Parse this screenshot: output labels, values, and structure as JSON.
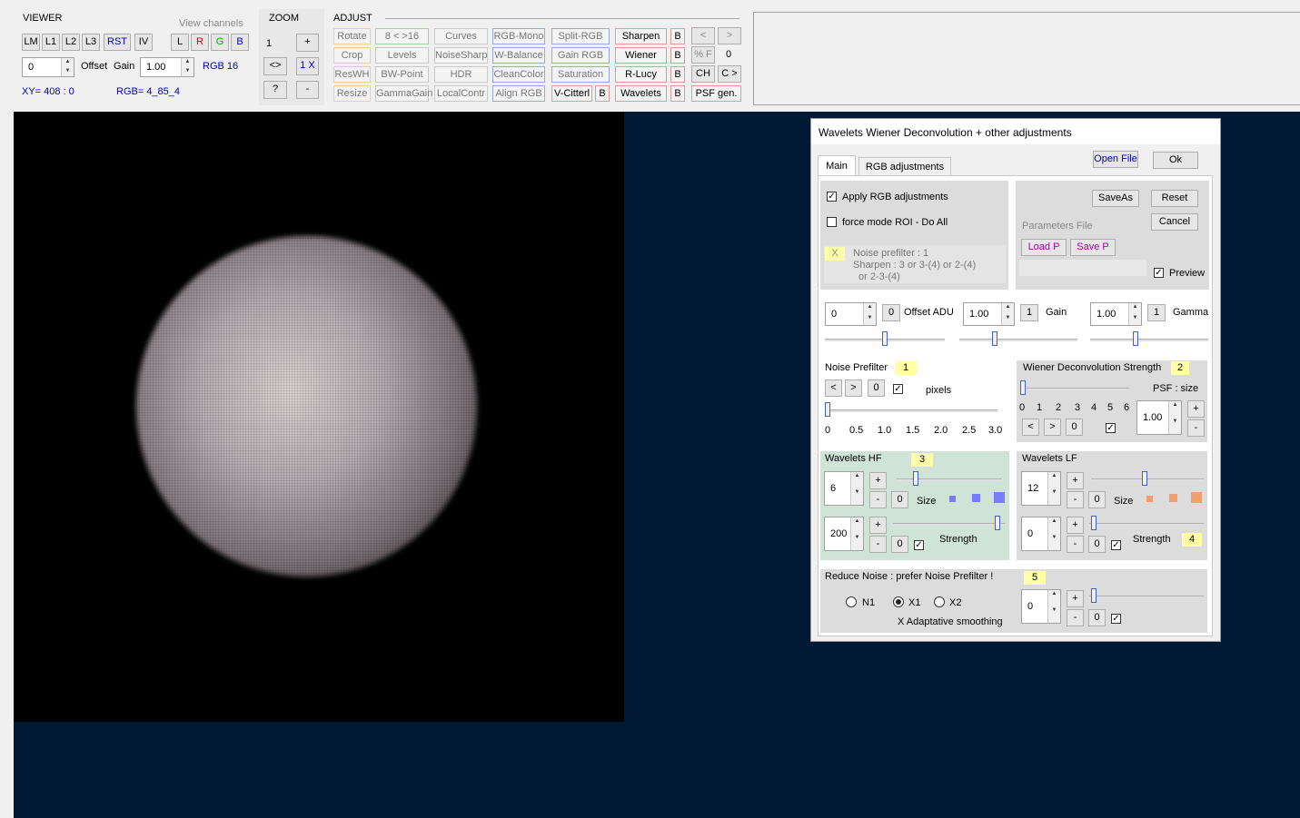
{
  "viewer": {
    "title": "VIEWER",
    "buttons": [
      "LM",
      "L1",
      "L2",
      "L3",
      "RST",
      "IV"
    ],
    "view_channels_label": "View channels",
    "channels": [
      "L",
      "R",
      "G",
      "B"
    ],
    "offset_value": "0",
    "offset_label": "Offset",
    "gain_label": "Gain",
    "gain_value": "1.00",
    "bitdepth": "RGB 16",
    "xy": "XY=  408 : 0",
    "rgb": "RGB=  4_85_4"
  },
  "zoom": {
    "title": "ZOOM",
    "level": "1",
    "plus": "+",
    "fit": "<>",
    "onex": "1 X",
    "help": "?",
    "minus": "-"
  },
  "adjust": {
    "title": "ADJUST",
    "col1": [
      "Rotate",
      "Crop",
      "ResWH",
      "Resize"
    ],
    "col2": [
      "8 < >16",
      "Levels",
      "BW-Point",
      "GammaGain"
    ],
    "col3": [
      "Curves",
      "NoiseSharp",
      "HDR",
      "LocalContr"
    ],
    "col4": [
      "RGB-Mono",
      "W-Balance",
      "CleanColor",
      "Align RGB"
    ],
    "col5": [
      "Split-RGB",
      "Gain RGB",
      "Saturation",
      "V-Citterl"
    ],
    "col6": [
      "Sharpen",
      "Wiener",
      "R-Lucy",
      "Wavelets"
    ],
    "b": "B",
    "prev": "<",
    "next": ">",
    "pctf": "% F",
    "count": "0",
    "ch": "CH",
    "cnext": "C >",
    "psf": "PSF gen."
  },
  "dialog": {
    "title": "Wavelets Wiener Deconvolution + other adjustments",
    "tabs": [
      "Main",
      "RGB adjustments"
    ],
    "open_file": "Open File",
    "ok": "Ok",
    "apply_rgb": "Apply RGB adjustments",
    "force_mode": "force mode  ROI - Do All",
    "x_mark": "X",
    "noise_info1": "Noise prefilter :  1",
    "noise_info2": "Sharpen :   3  or  3-(4)  or  2-(4)",
    "noise_info3": "or  2-3-(4)",
    "saveas": "SaveAs",
    "reset": "Reset",
    "cancel": "Cancel",
    "params_file": "Parameters File",
    "load_p": "Load P",
    "save_p": "Save P",
    "preview": "Preview",
    "offset_value": "0",
    "offset_label": "Offset ADU",
    "gain_value": "1.00",
    "gain_label": "Gain",
    "gamma_value": "1.00",
    "gamma_label": "Gamma",
    "zero": "0",
    "one": "1",
    "noise_prefilter": "Noise Prefilter",
    "np_badge": "1",
    "pixels": "pixels",
    "np_scale": [
      "0",
      "0.5",
      "1.0",
      "1.5",
      "2.0",
      "2.5",
      "3.0"
    ],
    "wiener_title": "Wiener Deconvolution Strength",
    "wiener_badge": "2",
    "psf_size": "PSF : size",
    "wiener_scale": [
      "0",
      "1",
      "2",
      "3",
      "4",
      "5",
      "6"
    ],
    "psf_value": "1.00",
    "whf_title": "Wavelets HF",
    "whf_badge": "3",
    "whf_size_value": "6",
    "whf_strength_value": "200",
    "size_label": "Size",
    "strength_label": "Strength",
    "wlf_title": "Wavelets LF",
    "wlf_size_value": "12",
    "wlf_strength_value": "0",
    "wlf_badge": "4",
    "reduce_noise": "Reduce Noise :  prefer Noise Prefilter !",
    "rn_badge": "5",
    "n1": "N1",
    "x1": "X1",
    "x2": "X2",
    "adaptive": "X Adaptative smoothing",
    "rn_value": "0",
    "plus": "+",
    "minus": "-",
    "lt": "<",
    "gt": ">",
    "check": "✓"
  },
  "colors": {
    "workspace": "#001a33",
    "image_bg": "#000000",
    "accent_blue": "#0000c0",
    "hf_panel": "#cfe3d6",
    "badge": "#ffffa8"
  }
}
